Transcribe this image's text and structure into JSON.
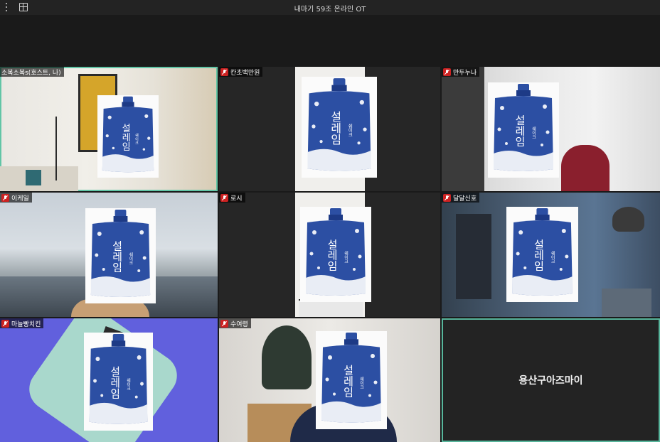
{
  "window": {
    "title": "내마기 59조 온라인 OT"
  },
  "participants": [
    {
      "name": "소복소복s(호스트, 나)",
      "muted": true
    },
    {
      "name": "칸초백만원",
      "muted": true
    },
    {
      "name": "만두누나",
      "muted": true
    },
    {
      "name": "이케일",
      "muted": true
    },
    {
      "name": "로시",
      "muted": true
    },
    {
      "name": "달달신호",
      "muted": true
    },
    {
      "name": "마늘빵치킨",
      "muted": true
    },
    {
      "name": "수여령",
      "muted": true
    },
    {
      "name": "용산구아즈마이",
      "muted": false
    }
  ],
  "card": {
    "brand_text": "설레임",
    "side_text": "쉐이크"
  },
  "colors": {
    "active_border": "#62c5a6",
    "muted_icon": "#cc2222",
    "pouch_blue": "#2c4fa3"
  }
}
